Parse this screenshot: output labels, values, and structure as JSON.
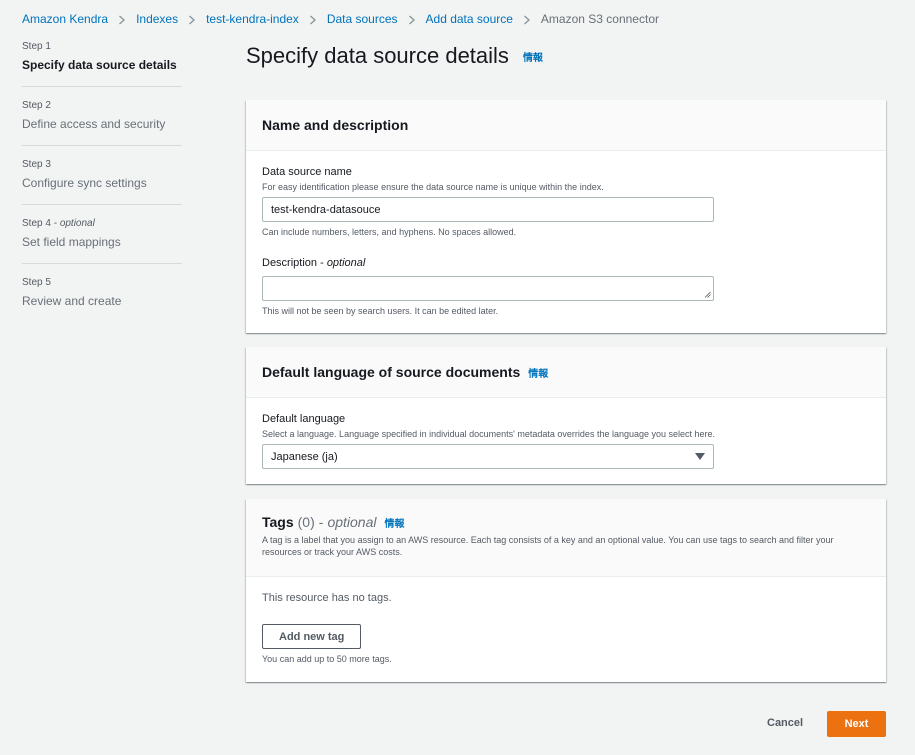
{
  "breadcrumb": {
    "items": [
      "Amazon Kendra",
      "Indexes",
      "test-kendra-index",
      "Data sources",
      "Add data source"
    ],
    "current": "Amazon S3 connector"
  },
  "steps": [
    {
      "num": "Step 1",
      "title": "Specify data source details"
    },
    {
      "num": "Step 2",
      "title": "Define access and security"
    },
    {
      "num": "Step 3",
      "title": "Configure sync settings"
    },
    {
      "num": "Step 4",
      "optional": "optional",
      "title": "Set field mappings"
    },
    {
      "num": "Step 5",
      "title": "Review and create"
    }
  ],
  "page": {
    "title": "Specify data source details",
    "info": "情報"
  },
  "name_panel": {
    "title": "Name and description",
    "name_label": "Data source name",
    "name_desc": "For easy identification please ensure the data source name is unique within the index.",
    "name_value": "test-kendra-datasouce",
    "name_hint": "Can include numbers, letters, and hyphens. No spaces allowed.",
    "desc_label": "Description",
    "desc_optional": "optional",
    "desc_value": "",
    "desc_hint": "This will not be seen by search users. It can be edited later."
  },
  "language_panel": {
    "title": "Default language of source documents",
    "info": "情報",
    "label": "Default language",
    "desc": "Select a language. Language specified in individual documents' metadata overrides the language you select here.",
    "value": "Japanese (ja)"
  },
  "tags_panel": {
    "title": "Tags",
    "count": "(0)",
    "optional": "optional",
    "info": "情報",
    "desc": "A tag is a label that you assign to an AWS resource. Each tag consists of a key and an optional value. You can use tags to search and filter your resources or track your AWS costs.",
    "empty": "This resource has no tags.",
    "add_button": "Add new tag",
    "limit_hint": "You can add up to 50 more tags."
  },
  "footer": {
    "cancel": "Cancel",
    "next": "Next"
  },
  "colors": {
    "link": "#0073bb",
    "primary": "#ec7211",
    "background": "#f2f3f3"
  }
}
